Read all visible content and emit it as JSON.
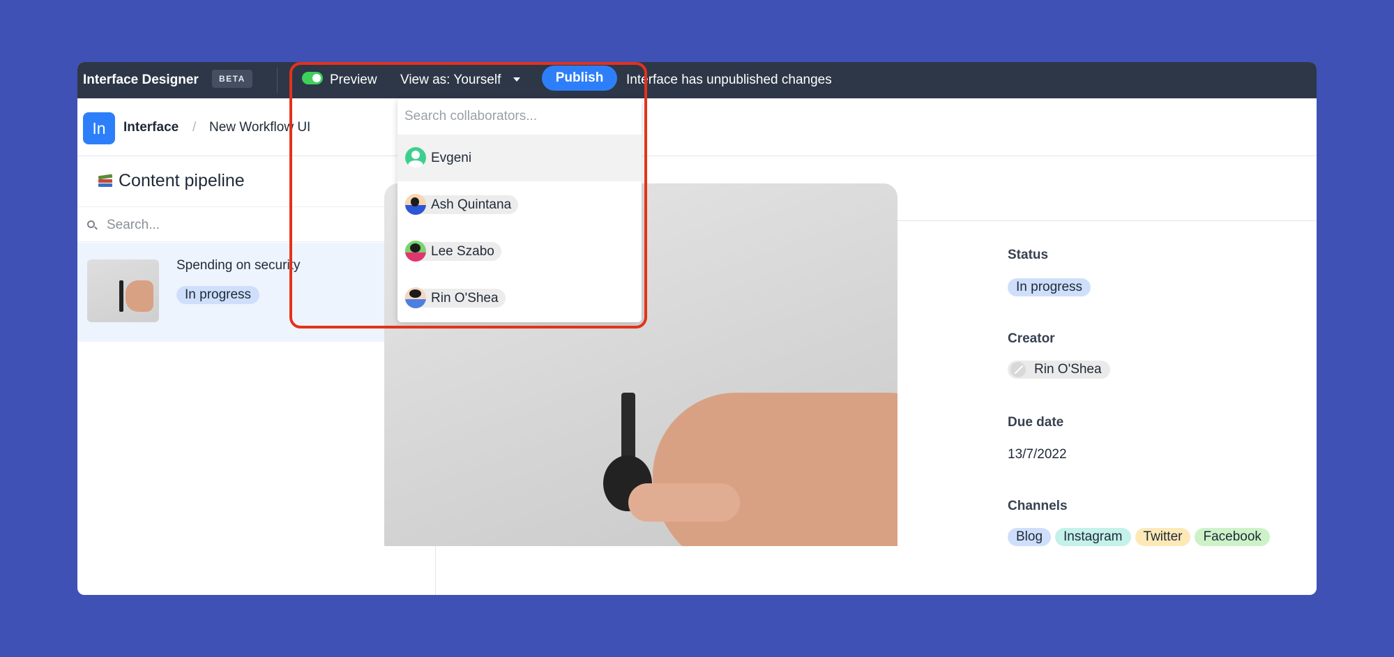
{
  "topbar": {
    "app_title": "Interface Designer",
    "beta_badge": "BETA",
    "preview_label": "Preview",
    "view_as_label": "View as: Yourself",
    "publish_label": "Publish",
    "unpublished_message": "Interface has unpublished changes"
  },
  "breadcrumb": {
    "logo_text": "In",
    "items": [
      "Interface",
      "New Workflow UI"
    ],
    "separator": "/"
  },
  "sidebar": {
    "title": "Content pipeline",
    "search_placeholder": "Search...",
    "records": [
      {
        "title": "Spending on security",
        "status": "In progress"
      }
    ]
  },
  "detail": {
    "fields": [
      {
        "label": "Status",
        "value": "In progress"
      },
      {
        "label": "Creator",
        "value": "Rin O'Shea"
      },
      {
        "label": "Due date",
        "value": "13/7/2022"
      },
      {
        "label": "Channels",
        "values": [
          "Blog",
          "Instagram",
          "Twitter",
          "Facebook"
        ]
      }
    ]
  },
  "dropdown": {
    "search_placeholder": "Search collaborators...",
    "collaborators": [
      {
        "name": "Evgeni",
        "avatar": "generic-user-icon",
        "highlighted": true
      },
      {
        "name": "Ash Quintana",
        "avatar": "ash-avatar"
      },
      {
        "name": "Lee Szabo",
        "avatar": "lee-avatar"
      },
      {
        "name": "Rin O'Shea",
        "avatar": "rin-avatar"
      }
    ]
  },
  "colors": {
    "background": "#3f51b5",
    "topbar": "#2d3748",
    "accent": "#2d7ff9",
    "toggle_on": "#3ecf5c",
    "highlight_border": "#e4321b"
  }
}
